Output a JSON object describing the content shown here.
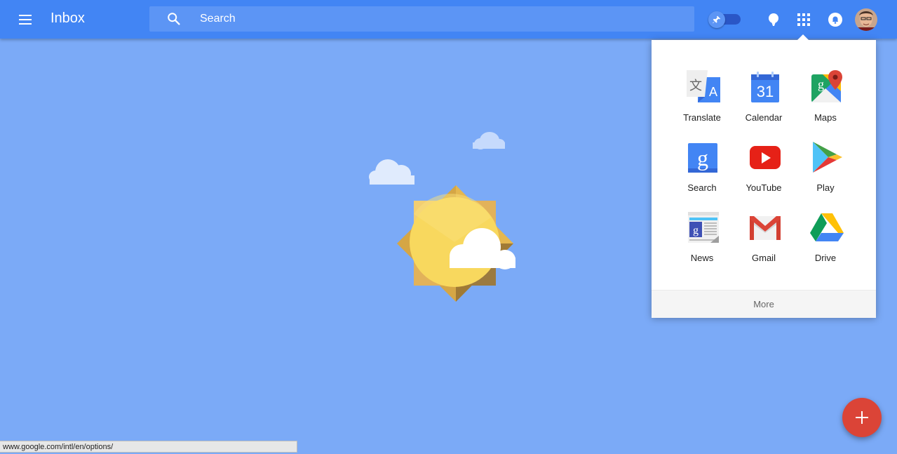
{
  "header": {
    "title": "Inbox",
    "search_placeholder": "Search",
    "menu_icon": "hamburger-menu-icon",
    "pin_icon": "pushpin-icon",
    "reminder_icon": "reminder-bulb-icon",
    "apps_icon": "apps-grid-icon",
    "notifications_icon": "notification-bell-icon"
  },
  "apps_panel": {
    "apps": [
      {
        "label": "Translate",
        "icon": "translate-icon"
      },
      {
        "label": "Calendar",
        "icon": "calendar-icon",
        "icon_text": "31"
      },
      {
        "label": "Maps",
        "icon": "maps-icon"
      },
      {
        "label": "Search",
        "icon": "google-search-icon",
        "icon_text": "g"
      },
      {
        "label": "YouTube",
        "icon": "youtube-icon"
      },
      {
        "label": "Play",
        "icon": "play-store-icon"
      },
      {
        "label": "News",
        "icon": "news-icon",
        "icon_text": "g"
      },
      {
        "label": "Gmail",
        "icon": "gmail-icon"
      },
      {
        "label": "Drive",
        "icon": "drive-icon"
      }
    ],
    "more_label": "More"
  },
  "fab": {
    "icon": "plus-icon"
  },
  "status_bar": {
    "url": "www.google.com/intl/en/options/"
  },
  "colors": {
    "header": "#4285f4",
    "background": "#7baaf7",
    "fab": "#db4437"
  }
}
